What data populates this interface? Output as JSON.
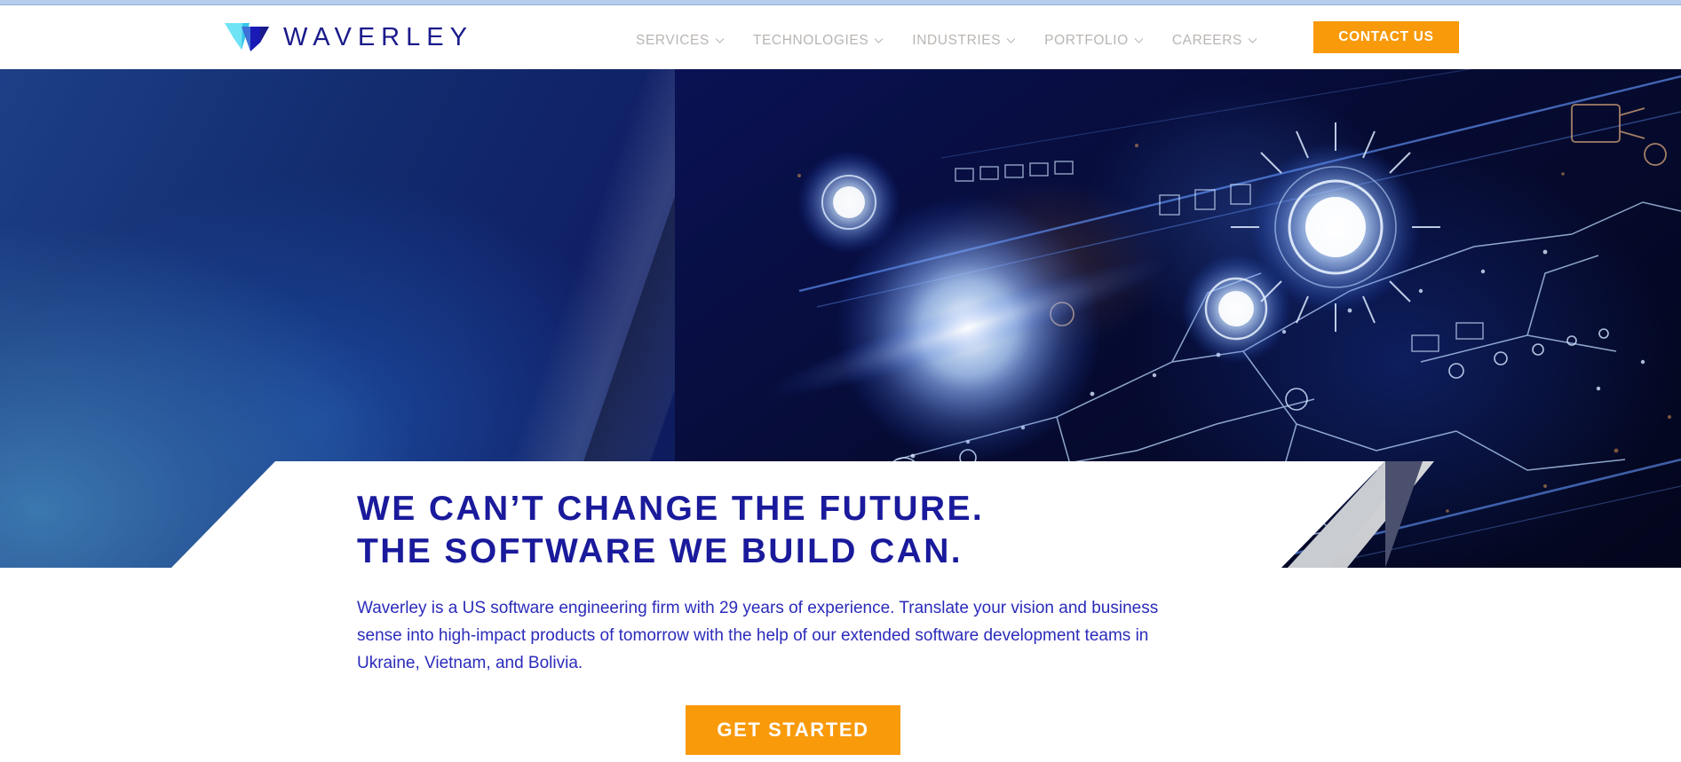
{
  "brand": {
    "name": "WAVERLEY",
    "logo_icon": "waverley-double-v-logo",
    "colors": {
      "brand_blue": "#1a1a8c",
      "headline_blue": "#1a1a9c",
      "accent_orange": "#f99a0b",
      "nav_grey": "#b9b5b2",
      "body_blue": "#2b2bbb"
    }
  },
  "header": {
    "nav": [
      {
        "label": "SERVICES",
        "has_dropdown": true
      },
      {
        "label": "TECHNOLOGIES",
        "has_dropdown": true
      },
      {
        "label": "INDUSTRIES",
        "has_dropdown": true
      },
      {
        "label": "PORTFOLIO",
        "has_dropdown": true
      },
      {
        "label": "CAREERS",
        "has_dropdown": true
      }
    ],
    "contact_label": "CONTACT US"
  },
  "hero": {
    "headline_line1": "WE CAN’T CHANGE THE FUTURE.",
    "headline_line2": "THE SOFTWARE WE BUILD CAN.",
    "paragraph": "Waverley is a US software engineering firm with 29 years of experience. Translate your vision and business sense into high-impact products of tomorrow with the help of our extended software development teams in Ukraine, Vietnam, and Bolivia.",
    "cta_label": "GET STARTED",
    "background_description": "abstract blue circuit-board technology artwork with glowing nodes"
  }
}
